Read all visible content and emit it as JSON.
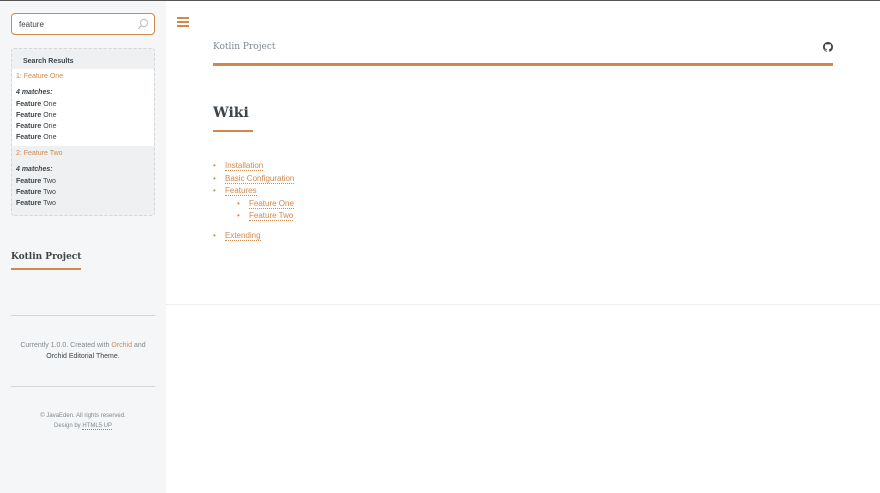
{
  "search": {
    "value": "feature",
    "placeholder": ""
  },
  "results": {
    "heading": "Search Results",
    "items": [
      {
        "title": "1: Feature One",
        "matches_label": "4 matches:",
        "lines": [
          {
            "bold": "Feature",
            "rest": " One"
          },
          {
            "bold": "Feature",
            "rest": " One"
          },
          {
            "bold": "Feature",
            "rest": " One"
          },
          {
            "bold": "Feature",
            "rest": " One"
          }
        ]
      },
      {
        "title": "2: Feature Two",
        "matches_label": "4 matches:",
        "lines": [
          {
            "bold": "Feature",
            "rest": " Two"
          },
          {
            "bold": "Feature",
            "rest": " Two"
          },
          {
            "bold": "Feature",
            "rest": " Two"
          }
        ]
      }
    ]
  },
  "sidebar": {
    "title": "Kotlin Project",
    "credit_prefix": "Currently 1.0.0. Created with ",
    "credit_link1": "Orchid",
    "credit_and": " and ",
    "credit_link2": "Orchid Editorial Theme",
    "credit_suffix": ".",
    "copyright": "© JavaEden. All rights reserved.",
    "design_prefix": "Design by ",
    "design_link": "HTML5 UP"
  },
  "header": {
    "title": "Kotlin Project",
    "github_icon": "github-icon",
    "menu_icon": "hamburger-menu-icon"
  },
  "page": {
    "title": "Wiki",
    "links": {
      "installation": "Installation",
      "basic_configuration": "Basic Configuration",
      "features": "Features",
      "feature_one": "Feature One",
      "feature_two": "Feature Two",
      "extending": "Extending"
    }
  },
  "colors": {
    "accent": "#d0894b",
    "text": "#3d4449",
    "sidebar_bg": "#f5f6f7"
  }
}
